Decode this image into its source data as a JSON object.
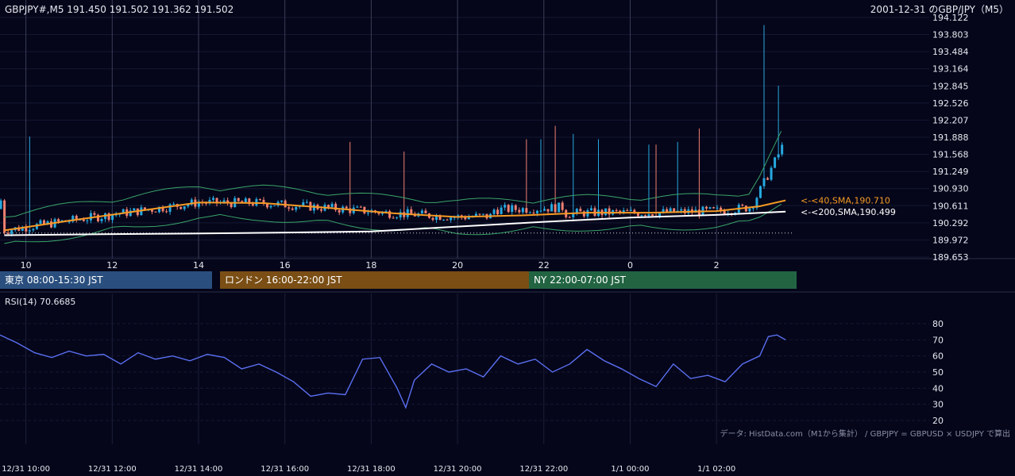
{
  "header": {
    "left": "GBPJPY#,M5 191.450 191.502 191.362 191.502",
    "right": "2001-12-31 のGBP/JPY（M5）"
  },
  "main_chart": {
    "y_ticks": [
      194.122,
      193.803,
      193.484,
      193.164,
      192.845,
      192.526,
      192.207,
      191.888,
      191.568,
      191.249,
      190.93,
      190.611,
      190.292,
      189.972,
      189.653
    ],
    "y_range": [
      189.653,
      194.122
    ],
    "x_hour_ticks": [
      "10",
      "12",
      "14",
      "16",
      "18",
      "20",
      "22",
      "0",
      "2"
    ],
    "x_hour_values": [
      10,
      12,
      14,
      16,
      18,
      20,
      22,
      24,
      26
    ],
    "x_range": [
      9.4,
      27.8
    ],
    "ref_level": 190.1,
    "sma40_label": "<-<40,SMA,190.710",
    "sma200_label": "<-<200,SMA,190.499",
    "colors": {
      "up": "#26a9e0",
      "down": "#f08070",
      "sma40": "#f59a23",
      "sma200": "#ffffff",
      "bb": "#3aa56a"
    }
  },
  "sessions": [
    {
      "label": "東京 08:00-15:30 JST",
      "color": "#2a4f7e"
    },
    {
      "label": "ロンドン 16:00-22:00 JST",
      "color": "#7a4e14"
    },
    {
      "label": "NY 22:00-07:00 JST",
      "color": "#226442"
    }
  ],
  "rsi": {
    "label": "RSI(14) 70.6685",
    "y_ticks": [
      80,
      70,
      60,
      50,
      40,
      30,
      20
    ],
    "y_range": [
      20,
      80
    ],
    "color": "#5a6ff0"
  },
  "x_time_ticks": [
    "12/31 10:00",
    "12/31 12:00",
    "12/31 14:00",
    "12/31 16:00",
    "12/31 18:00",
    "12/31 20:00",
    "12/31 22:00",
    "1/1 00:00",
    "1/1 02:00"
  ],
  "footer_note": "データ: HistData.com（M1から集計） / GBPJPY = GBPUSD × USDJPY で算出",
  "chart_data": {
    "type": "candlestick",
    "symbol": "GBPJPY#",
    "timeframe": "M5",
    "series": [
      {
        "name": "SMA40",
        "x": [
          9.5,
          11,
          12.5,
          14,
          15.5,
          17,
          18.5,
          20,
          21.5,
          23,
          24.5,
          26,
          27,
          27.6
        ],
        "values": [
          190.15,
          190.33,
          190.5,
          190.67,
          190.66,
          190.57,
          190.47,
          190.4,
          190.43,
          190.48,
          190.48,
          190.51,
          190.6,
          190.71
        ]
      },
      {
        "name": "SMA200",
        "x": [
          9.5,
          12,
          15,
          18,
          20,
          22,
          24,
          26,
          27.6
        ],
        "values": [
          190.06,
          190.08,
          190.1,
          190.13,
          190.22,
          190.31,
          190.39,
          190.44,
          190.5
        ]
      }
    ],
    "rsi14": {
      "x": [
        9.4,
        9.8,
        10.2,
        10.6,
        11.0,
        11.4,
        11.8,
        12.2,
        12.6,
        13.0,
        13.4,
        13.8,
        14.2,
        14.6,
        15.0,
        15.4,
        15.8,
        16.2,
        16.6,
        17.0,
        17.4,
        17.8,
        18.2,
        18.6,
        18.8,
        19.0,
        19.4,
        19.8,
        20.2,
        20.6,
        21.0,
        21.4,
        21.8,
        22.2,
        22.6,
        23.0,
        23.4,
        23.8,
        24.2,
        24.6,
        25.0,
        25.4,
        25.8,
        26.2,
        26.6,
        27.0,
        27.2,
        27.4,
        27.6
      ],
      "values": [
        73,
        68,
        62,
        59,
        63,
        60,
        61,
        55,
        62,
        58,
        60,
        57,
        61,
        59,
        52,
        55,
        50,
        44,
        35,
        37,
        36,
        58,
        59,
        40,
        28,
        45,
        55,
        50,
        52,
        47,
        60,
        55,
        58,
        50,
        55,
        64,
        57,
        52,
        46,
        41,
        55,
        46,
        48,
        44,
        55,
        60,
        72,
        73,
        70
      ]
    }
  }
}
